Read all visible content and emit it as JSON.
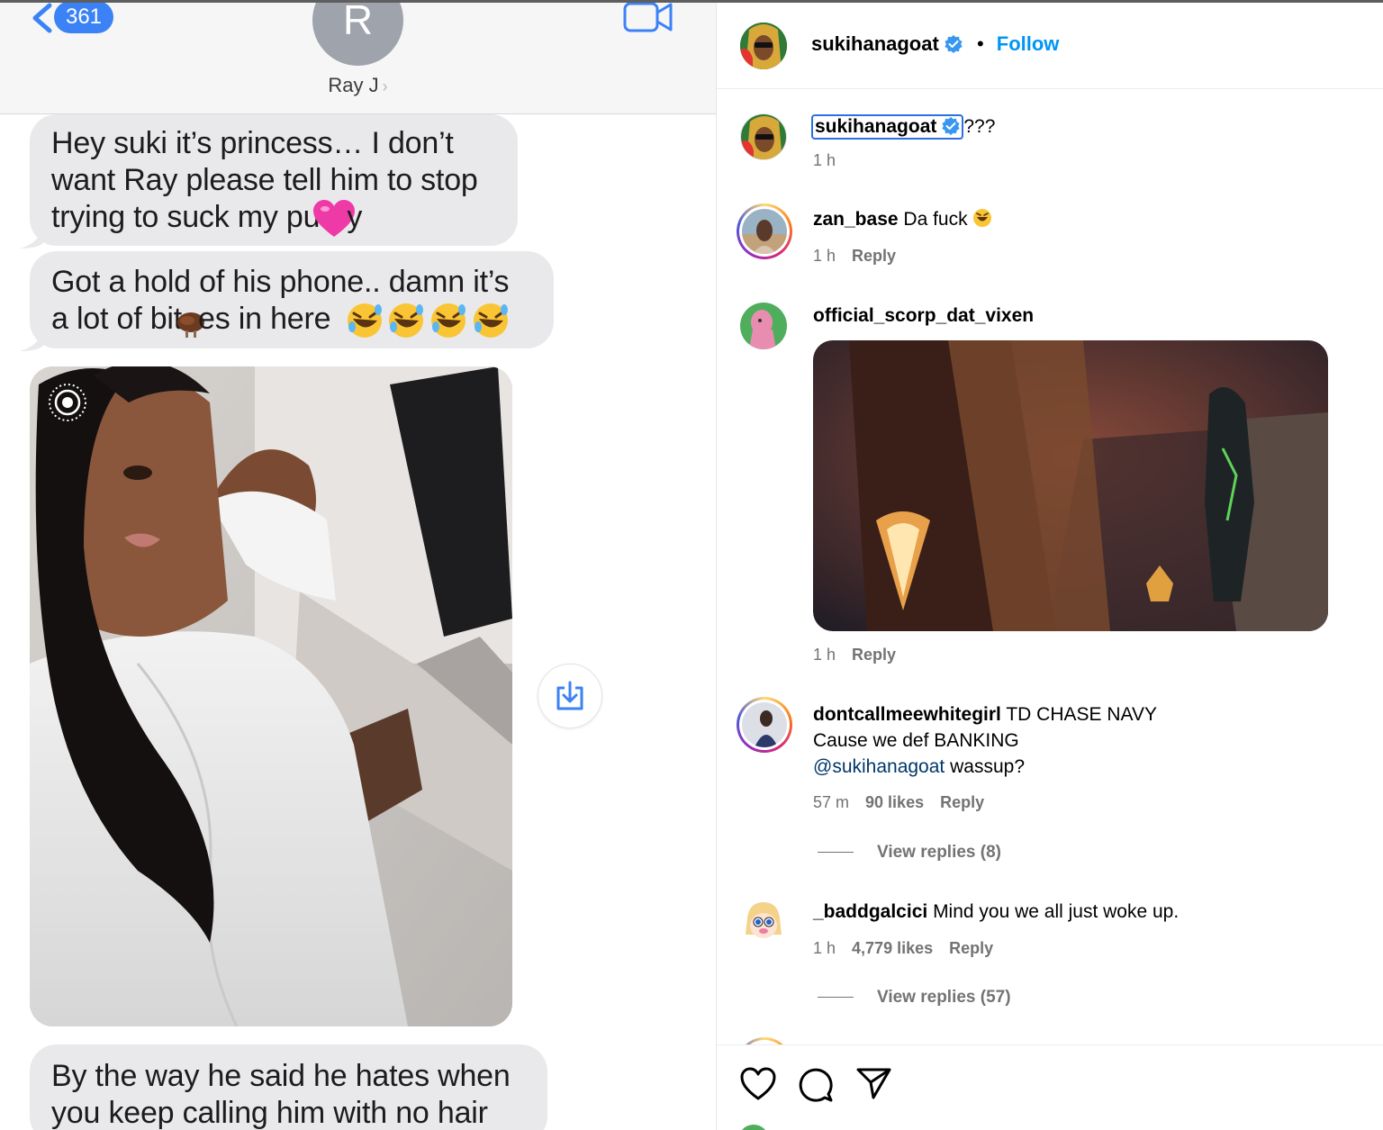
{
  "imessage": {
    "unread_count": "361",
    "contact_initial": "R",
    "contact_name": "Ray J",
    "bubble1_lines": [
      "Hey suki it’s princess… I don’t",
      "want Ray please tell him to stop",
      "trying to suck my pu",
      "y"
    ],
    "bubble2_lines": [
      "Got a hold of his phone.. damn it’s",
      "a lot of bit",
      "es in here"
    ],
    "bubble3_lines": [
      "By the way he said he hates when",
      "you keep calling him with no hair"
    ],
    "icons": [
      "chevron-left-icon",
      "video-camera-icon",
      "heart-emoji",
      "turkey-emoji",
      "rofl-emoji",
      "live-photo-icon",
      "download-icon"
    ],
    "accent_color": "#3b82f6",
    "bubble_color": "#e9e9eb"
  },
  "instagram": {
    "header": {
      "username": "sukihanagoat",
      "dot": "•",
      "follow_label": "Follow"
    },
    "comments": [
      {
        "username": "sukihanagoat",
        "text": "???",
        "time": "1 h"
      },
      {
        "username": "zan_base",
        "text": "Da fuck",
        "time": "1 h",
        "reply": "Reply"
      },
      {
        "username": "official_scorp_dat_vixen",
        "text": "",
        "time": "1 h",
        "reply": "Reply"
      },
      {
        "username": "dontcallmeewhitegirl",
        "line1": "TD CHASE NAVY",
        "line2": "Cause we def BANKING",
        "mention": "@sukihanagoat",
        "line3": "wassup?",
        "time": "57 m",
        "likes": "90 likes",
        "reply": "Reply",
        "view_replies": "View replies (8)"
      },
      {
        "username": "_baddgalcici",
        "text": "Mind you we all just woke up.",
        "time": "1 h",
        "likes": "4,779 likes",
        "reply": "Reply",
        "view_replies": "View replies (57)"
      }
    ],
    "footer_icons": [
      "heart-icon",
      "comment-icon",
      "share-icon"
    ],
    "link_color": "#0095f6",
    "verified_color": "#3897f0"
  }
}
